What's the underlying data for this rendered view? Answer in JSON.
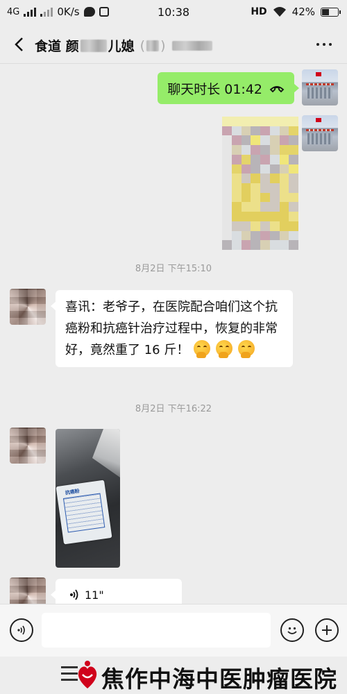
{
  "status_bar": {
    "network": "4G",
    "speed": "0K/s",
    "time": "10:38",
    "hd": "HD",
    "battery": "42%"
  },
  "header": {
    "title_prefix": "食道 颜",
    "title_mid": "儿媳",
    "back_icon": "chevron-left-icon",
    "more_icon": "more-dots-icon"
  },
  "messages": {
    "call": {
      "label": "聊天时长 01:42",
      "icon": "phone-hangup-icon"
    },
    "time1": "8月2日 下午15:10",
    "text1": "喜讯：老爷子，在医院配合咱们这个抗癌粉和抗癌针治疗过程中，恢复的非常好，竟然重了 16 斤！",
    "time2": "8月2日 下午16:22",
    "photo_label": "抗癌粉",
    "voice": {
      "duration": "11\"",
      "icon": "voice-wave-icon"
    }
  },
  "input_bar": {
    "voice_icon": "voice-toggle-icon",
    "emoji_icon": "emoji-icon",
    "plus_icon": "plus-icon"
  },
  "watermark": {
    "text": "焦作中海中医肿瘤医院",
    "colors": {
      "logo_red": "#d0021b"
    }
  },
  "colors": {
    "background": "#ededed",
    "sent_bubble": "#95ec69",
    "received_bubble": "#ffffff"
  }
}
